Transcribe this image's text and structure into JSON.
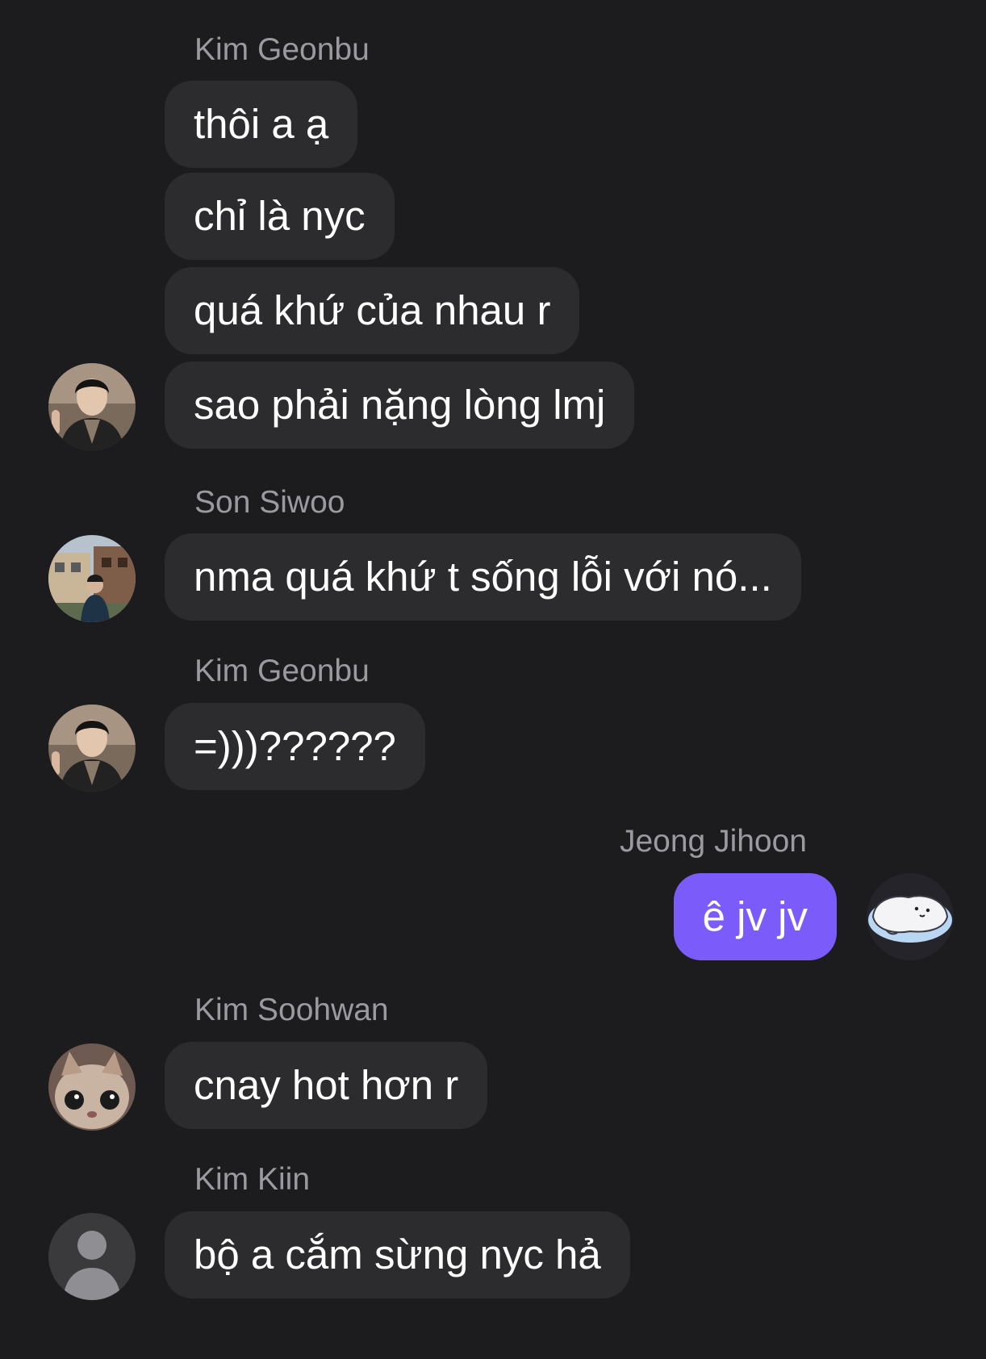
{
  "messages": [
    {
      "sender": "Kim Geonbu",
      "bubbles": [
        "thôi a ạ",
        "chỉ là nyc",
        "quá khứ của nhau r",
        "sao phải nặng lòng lmj"
      ]
    },
    {
      "sender": "Son Siwoo",
      "bubbles": [
        "nma quá khứ t sống lỗi với nó..."
      ]
    },
    {
      "sender": "Kim Geonbu",
      "bubbles": [
        "=)))??????"
      ]
    },
    {
      "sender": "Jeong Jihoon",
      "bubbles": [
        "ê jv jv"
      ],
      "mine": true
    },
    {
      "sender": "Kim Soohwan",
      "bubbles": [
        "cnay hot hơn r"
      ]
    },
    {
      "sender": "Kim Kiin",
      "bubbles": [
        "bộ a cắm sừng nyc hả"
      ]
    }
  ],
  "colors": {
    "background": "#1c1c1e",
    "incoming_bubble": "#2c2c2e",
    "outgoing_bubble": "#7b5cfa",
    "sender_name": "#9a9aa0"
  },
  "icons": {
    "default_avatar": "person-silhouette-icon"
  }
}
